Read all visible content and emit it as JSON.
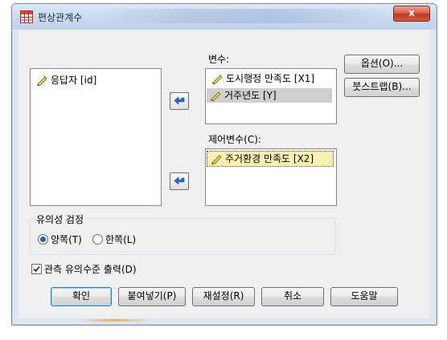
{
  "window": {
    "title": "편상관계수",
    "close_label": "x"
  },
  "source_list": {
    "items": [
      "응답자 [id]"
    ]
  },
  "variables": {
    "label": "변수:",
    "items": [
      "도시행정 만족도 [X1]",
      "거주년도 [Y]"
    ]
  },
  "controls": {
    "label": "제어변수(C):",
    "items": [
      "주거환경 만족도 [X2]"
    ]
  },
  "side_buttons": {
    "options": "옵션(O)...",
    "bootstrap": "붓스트랩(B)..."
  },
  "significance": {
    "title": "유의성 검정",
    "two_tailed": "양쪽(T)",
    "one_tailed": "한쪽(L)",
    "selected": "양쪽(T)"
  },
  "flag": {
    "label": "관측 유의수준 출력(D)",
    "checked": true
  },
  "bottom_buttons": {
    "ok": "확인",
    "paste": "붙여넣기(P)",
    "reset": "재설정(R)",
    "cancel": "취소",
    "help": "도움말"
  },
  "icons": {
    "app": "table-grid-icon",
    "variable": "ruler-pencil-icon",
    "move": "arrow-left-icon"
  }
}
